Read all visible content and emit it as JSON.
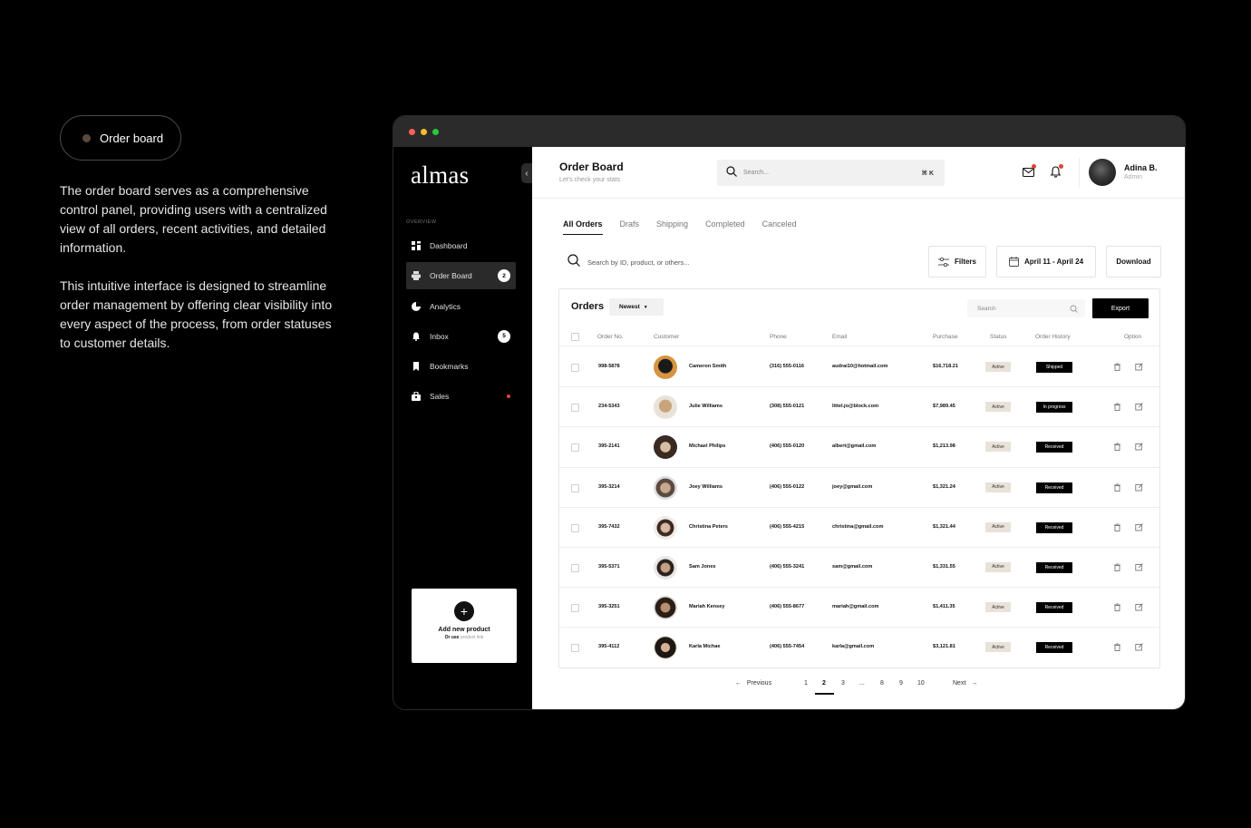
{
  "promo": {
    "pill_label": "Order board",
    "paragraphs": [
      "The order board serves as a comprehensive control panel, providing users with a centralized view of all orders, recent activities, and detailed information.",
      "This intuitive interface is designed to streamline order management by offering clear visibility into every aspect of the process, from order statuses to customer details."
    ]
  },
  "sidebar": {
    "logo": "almas",
    "section_label": "OVERVIEW",
    "items": [
      {
        "label": "Dashboard",
        "icon": "grid-icon"
      },
      {
        "label": "Order Board",
        "icon": "printer-icon",
        "badge": "2",
        "active": true
      },
      {
        "label": "Analytics",
        "icon": "pie-chart-icon"
      },
      {
        "label": "Inbox",
        "icon": "bell-icon",
        "badge": "5"
      },
      {
        "label": "Bookmarks",
        "icon": "bookmark-icon"
      },
      {
        "label": "Sales",
        "icon": "bag-icon",
        "dot": true
      }
    ],
    "add_card": {
      "title": "Add new product",
      "sub_prefix": "Or use",
      "sub_link": "product link"
    }
  },
  "header": {
    "title": "Order Board",
    "subtitle": "Let's check your stats",
    "search_placeholder": "Search...",
    "shortcut": "⌘ K",
    "user_name": "Adina B.",
    "user_role": "Admin"
  },
  "tabs": [
    "All Orders",
    "Drafs",
    "Shipping",
    "Completed",
    "Canceled"
  ],
  "toolbar": {
    "search_placeholder": "Search by ID, product, or others...",
    "filters_label": "Filters",
    "date_range": "April 11 - April 24",
    "download_label": "Download"
  },
  "orders": {
    "title": "Orders",
    "sort": "Newest",
    "search_placeholder": "Search",
    "export_label": "Export",
    "columns": [
      "Order No.",
      "Customer",
      "Phone",
      "Email",
      "Purchase",
      "Status",
      "Order History",
      "Option"
    ],
    "rows": [
      {
        "order_no": "998-5878",
        "customer": "Cameron Smith",
        "phone": "(316) 555-0116",
        "email": "audrai10@hotmail.com",
        "purchase": "$16,718.21",
        "status": "Active",
        "history": "Shipped"
      },
      {
        "order_no": "234-5343",
        "customer": "Julie Williams",
        "phone": "(308) 555-0121",
        "email": "littel.jo@block.com",
        "purchase": "$7,989.45",
        "status": "Active",
        "history": "In progress"
      },
      {
        "order_no": "395-2141",
        "customer": "Michael Philips",
        "phone": "(406) 555-0120",
        "email": "albert@gmail.com",
        "purchase": "$1,213.98",
        "status": "Active",
        "history": "Received"
      },
      {
        "order_no": "395-3214",
        "customer": "Joey Williams",
        "phone": "(406) 555-0122",
        "email": "joey@gmail.com",
        "purchase": "$1,321.24",
        "status": "Active",
        "history": "Received"
      },
      {
        "order_no": "395-7432",
        "customer": "Christina Peters",
        "phone": "(406) 555-4215",
        "email": "christina@gmail.com",
        "purchase": "$1,321.44",
        "status": "Active",
        "history": "Received"
      },
      {
        "order_no": "395-5371",
        "customer": "Sam Jones",
        "phone": "(406) 555-3241",
        "email": "sam@gmail.com",
        "purchase": "$1,331.55",
        "status": "Active",
        "history": "Received"
      },
      {
        "order_no": "395-3251",
        "customer": "Mariah Kensey",
        "phone": "(406) 555-8677",
        "email": "mariah@gmail.com",
        "purchase": "$1,411.35",
        "status": "Active",
        "history": "Received"
      },
      {
        "order_no": "395-4112",
        "customer": "Karla Michae",
        "phone": "(406) 555-7454",
        "email": "karla@gmail.com",
        "purchase": "$3,121.81",
        "status": "Active",
        "history": "Received"
      }
    ]
  },
  "pagination": {
    "previous": "Previous",
    "next": "Next",
    "pages": [
      "1",
      "2",
      "3",
      "...",
      "8",
      "9",
      "10"
    ],
    "current": "2"
  },
  "colors": {
    "accent_red": "#e0443a",
    "status_bg": "#e8e2d8",
    "traffic_lights": [
      "#ff5f57",
      "#febc2e",
      "#28c840"
    ]
  }
}
